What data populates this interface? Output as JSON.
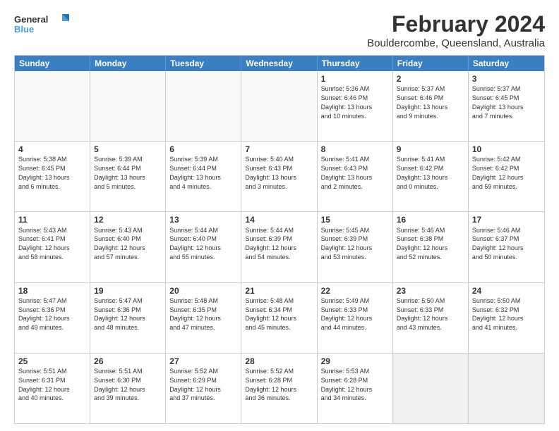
{
  "logo": {
    "line1": "General",
    "line2": "Blue"
  },
  "title": "February 2024",
  "subtitle": "Bouldercombe, Queensland, Australia",
  "header_days": [
    "Sunday",
    "Monday",
    "Tuesday",
    "Wednesday",
    "Thursday",
    "Friday",
    "Saturday"
  ],
  "rows": [
    [
      {
        "day": "",
        "text": "",
        "empty": true
      },
      {
        "day": "",
        "text": "",
        "empty": true
      },
      {
        "day": "",
        "text": "",
        "empty": true
      },
      {
        "day": "",
        "text": "",
        "empty": true
      },
      {
        "day": "1",
        "text": "Sunrise: 5:36 AM\nSunset: 6:46 PM\nDaylight: 13 hours\nand 10 minutes."
      },
      {
        "day": "2",
        "text": "Sunrise: 5:37 AM\nSunset: 6:46 PM\nDaylight: 13 hours\nand 9 minutes."
      },
      {
        "day": "3",
        "text": "Sunrise: 5:37 AM\nSunset: 6:45 PM\nDaylight: 13 hours\nand 7 minutes."
      }
    ],
    [
      {
        "day": "4",
        "text": "Sunrise: 5:38 AM\nSunset: 6:45 PM\nDaylight: 13 hours\nand 6 minutes."
      },
      {
        "day": "5",
        "text": "Sunrise: 5:39 AM\nSunset: 6:44 PM\nDaylight: 13 hours\nand 5 minutes."
      },
      {
        "day": "6",
        "text": "Sunrise: 5:39 AM\nSunset: 6:44 PM\nDaylight: 13 hours\nand 4 minutes."
      },
      {
        "day": "7",
        "text": "Sunrise: 5:40 AM\nSunset: 6:43 PM\nDaylight: 13 hours\nand 3 minutes."
      },
      {
        "day": "8",
        "text": "Sunrise: 5:41 AM\nSunset: 6:43 PM\nDaylight: 13 hours\nand 2 minutes."
      },
      {
        "day": "9",
        "text": "Sunrise: 5:41 AM\nSunset: 6:42 PM\nDaylight: 13 hours\nand 0 minutes."
      },
      {
        "day": "10",
        "text": "Sunrise: 5:42 AM\nSunset: 6:42 PM\nDaylight: 12 hours\nand 59 minutes."
      }
    ],
    [
      {
        "day": "11",
        "text": "Sunrise: 5:43 AM\nSunset: 6:41 PM\nDaylight: 12 hours\nand 58 minutes."
      },
      {
        "day": "12",
        "text": "Sunrise: 5:43 AM\nSunset: 6:40 PM\nDaylight: 12 hours\nand 57 minutes."
      },
      {
        "day": "13",
        "text": "Sunrise: 5:44 AM\nSunset: 6:40 PM\nDaylight: 12 hours\nand 55 minutes."
      },
      {
        "day": "14",
        "text": "Sunrise: 5:44 AM\nSunset: 6:39 PM\nDaylight: 12 hours\nand 54 minutes."
      },
      {
        "day": "15",
        "text": "Sunrise: 5:45 AM\nSunset: 6:39 PM\nDaylight: 12 hours\nand 53 minutes."
      },
      {
        "day": "16",
        "text": "Sunrise: 5:46 AM\nSunset: 6:38 PM\nDaylight: 12 hours\nand 52 minutes."
      },
      {
        "day": "17",
        "text": "Sunrise: 5:46 AM\nSunset: 6:37 PM\nDaylight: 12 hours\nand 50 minutes."
      }
    ],
    [
      {
        "day": "18",
        "text": "Sunrise: 5:47 AM\nSunset: 6:36 PM\nDaylight: 12 hours\nand 49 minutes."
      },
      {
        "day": "19",
        "text": "Sunrise: 5:47 AM\nSunset: 6:36 PM\nDaylight: 12 hours\nand 48 minutes."
      },
      {
        "day": "20",
        "text": "Sunrise: 5:48 AM\nSunset: 6:35 PM\nDaylight: 12 hours\nand 47 minutes."
      },
      {
        "day": "21",
        "text": "Sunrise: 5:48 AM\nSunset: 6:34 PM\nDaylight: 12 hours\nand 45 minutes."
      },
      {
        "day": "22",
        "text": "Sunrise: 5:49 AM\nSunset: 6:33 PM\nDaylight: 12 hours\nand 44 minutes."
      },
      {
        "day": "23",
        "text": "Sunrise: 5:50 AM\nSunset: 6:33 PM\nDaylight: 12 hours\nand 43 minutes."
      },
      {
        "day": "24",
        "text": "Sunrise: 5:50 AM\nSunset: 6:32 PM\nDaylight: 12 hours\nand 41 minutes."
      }
    ],
    [
      {
        "day": "25",
        "text": "Sunrise: 5:51 AM\nSunset: 6:31 PM\nDaylight: 12 hours\nand 40 minutes."
      },
      {
        "day": "26",
        "text": "Sunrise: 5:51 AM\nSunset: 6:30 PM\nDaylight: 12 hours\nand 39 minutes."
      },
      {
        "day": "27",
        "text": "Sunrise: 5:52 AM\nSunset: 6:29 PM\nDaylight: 12 hours\nand 37 minutes."
      },
      {
        "day": "28",
        "text": "Sunrise: 5:52 AM\nSunset: 6:28 PM\nDaylight: 12 hours\nand 36 minutes."
      },
      {
        "day": "29",
        "text": "Sunrise: 5:53 AM\nSunset: 6:28 PM\nDaylight: 12 hours\nand 34 minutes."
      },
      {
        "day": "",
        "text": "",
        "empty": true,
        "shaded": true
      },
      {
        "day": "",
        "text": "",
        "empty": true,
        "shaded": true
      }
    ]
  ]
}
